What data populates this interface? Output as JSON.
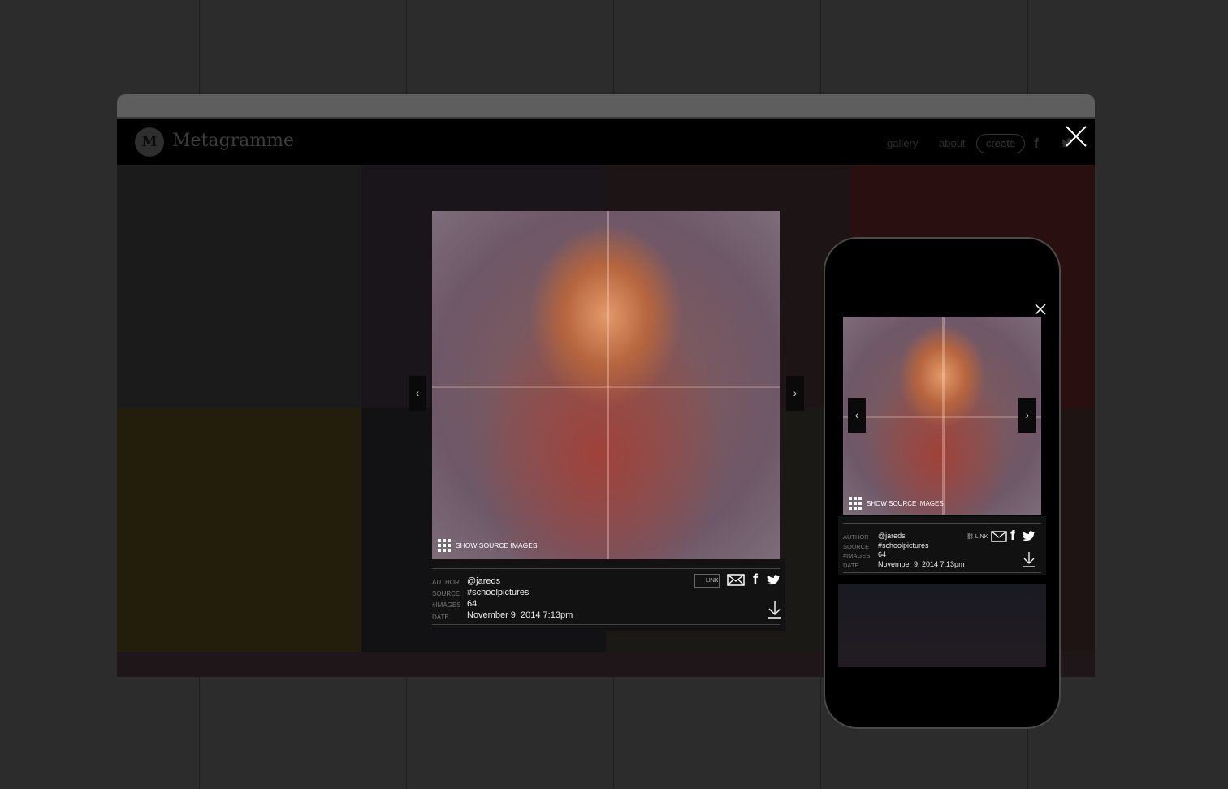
{
  "site": {
    "logo_letter": "M",
    "brand": "Metagramme",
    "nav": {
      "gallery": "gallery",
      "about": "about",
      "create": "create"
    }
  },
  "viewer": {
    "show_source": "SHOW SOURCE IMAGES",
    "prev": "‹",
    "next": "›",
    "link_label": "LINK",
    "labels": {
      "author": "AUTHOR",
      "source": "SOURCE",
      "images": "#IMAGES",
      "date": "DATE"
    },
    "values": {
      "author": "@jareds",
      "source": "#schoolpictures",
      "images": "64",
      "date": "November 9, 2014 7:13pm"
    }
  },
  "icons": {
    "close": "×",
    "facebook": "f"
  }
}
